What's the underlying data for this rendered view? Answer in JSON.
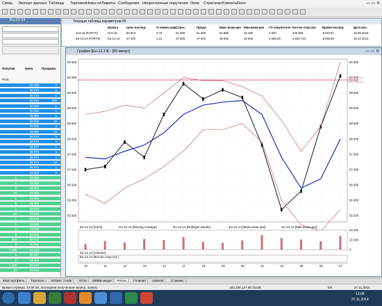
{
  "menu": [
    "Связь",
    "Экспорт данных",
    "Таблицы",
    "Торговля",
    "Новости",
    "Лимиты",
    "Сообщения",
    "Непрочтенные поручения",
    "Окна",
    "Стратегия",
    "Клиенты",
    "Окно"
  ],
  "order_book": {
    "title": "Eu-12.14",
    "columns": [
      "Покупка",
      "Цена",
      "Продажа"
    ],
    "pos_label": "POS",
    "rows": [
      {
        "price": "60 030",
        "sell": "1"
      },
      {
        "price": "60 020",
        "sell": "1"
      },
      {
        "price": "60 015",
        "sell": "1"
      },
      {
        "price": "60 010",
        "sell": "500"
      },
      {
        "price": "60 005",
        "sell": "1"
      },
      {
        "price": "60 000",
        "sell": "1"
      },
      {
        "price": "59 999",
        "sell": "5"
      },
      {
        "price": "59 988",
        "sell": "45"
      },
      {
        "price": "59 985",
        "sell": "6"
      },
      {
        "price": "59 980",
        "sell": "10"
      },
      {
        "price": "59 979",
        "sell": "2"
      },
      {
        "price": "59 978",
        "sell": "4"
      },
      {
        "price": "59 977",
        "sell": "1"
      },
      {
        "price": "59 976",
        "sell": "6"
      },
      {
        "price": "59 974",
        "sell": "2"
      },
      {
        "price": "59 972",
        "sell": "10"
      },
      {
        "price": "59 970",
        "sell": "1"
      },
      {
        "price": "59 965",
        "sell": "2"
      },
      {
        "buy": "1",
        "price": "59 960"
      },
      {
        "buy": "1",
        "price": "59 955"
      },
      {
        "buy": "2",
        "price": "59 954"
      },
      {
        "buy": "10",
        "price": "59 953"
      },
      {
        "buy": "1",
        "price": "59 950"
      },
      {
        "buy": "5",
        "price": "59 949"
      },
      {
        "buy": "1",
        "price": "59 948"
      },
      {
        "buy": "25",
        "price": "59 946"
      },
      {
        "buy": "1",
        "price": "59 945"
      },
      {
        "buy": "1",
        "price": "59 940"
      },
      {
        "buy": "1",
        "price": "59 939"
      },
      {
        "buy": "5",
        "price": "59 935"
      },
      {
        "buy": "489",
        "price": "59 932"
      },
      {
        "buy": "2",
        "price": "59 930"
      },
      {
        "buy": "2 000",
        "price": "59 928"
      },
      {
        "buy": "1",
        "price": "59 927"
      },
      {
        "buy": "1",
        "price": "59 925"
      },
      {
        "buy": "1 000",
        "price": "59 920"
      },
      {
        "buy": "10",
        "price": "59 915"
      }
    ]
  },
  "params_table": {
    "title": "Текущая таблица параметров #8",
    "headers": [
      "Бумага",
      "Цена послед.",
      "% измен.закр.",
      "Спрос",
      "Предл.",
      "Макс.возм.цен",
      "Мин.возм.цен",
      "ГО покупателя",
      "Кол-во откр.поз.",
      "Время послед.",
      "Дата исп."
    ],
    "rows": [
      [
        "Si-9.15 [FORTS]",
        "Si-9.15",
        "50 913",
        "0,75",
        "51 099",
        "51 500",
        "52 882",
        "48 180",
        "4 840",
        "333 828",
        "10:00:01",
        "15.09.2015"
      ],
      [
        "Eu-12.14 [FORTS]",
        "Eu-12.14",
        "47 922",
        "1,21",
        "47 920",
        "47 922",
        "48 652",
        "46 646",
        "2 606,00",
        "2 818 724",
        "10:08:25",
        "15.12.2014"
      ]
    ]
  },
  "chart_window": {
    "title": "График [Eu-12.14] - [60 минут]",
    "price_ticks": [
      "60 500",
      "60 000",
      "59 500",
      "59 000",
      "58 500",
      "58 000",
      "57 500",
      "57 000",
      "56 500",
      "56 000",
      "55 500"
    ],
    "last_price_tag": "59 920",
    "legend_main": [
      "Eu-12.14 [Price]",
      "Eu-12.14 [Moving Average]",
      "Eu-12.14 [Bollinger Bands]",
      "Eu-12.14 [Макс.возм.цен]",
      "Eu-12.14 [Мин.возм.цен]"
    ],
    "volume_label": "Eu-12.14 [Volume]",
    "volume_ticks": [
      "40 000",
      "20 000",
      "0"
    ],
    "oi_label": "Eu-12.14 [Кол-во откр.поз.]",
    "dates": [
      "10",
      "11",
      "12",
      "13",
      "14",
      "17",
      "18",
      "19",
      "20",
      "21",
      "24",
      "25",
      "26",
      "27"
    ],
    "colors": {
      "price": "#000000",
      "ma": "#1a2fb5",
      "bands": "#c04a4a",
      "volume": "#d07070",
      "hline": "#c83c78"
    }
  },
  "chart_data": {
    "type": "line",
    "title": "График [Eu-12.14] - [60 минут]",
    "x": [
      "10",
      "11",
      "12",
      "13",
      "14",
      "17",
      "18",
      "19",
      "20",
      "21",
      "24",
      "25",
      "26",
      "27"
    ],
    "series": [
      {
        "name": "Eu-12.14 [Price]",
        "values": [
          57000,
          57100,
          57900,
          57400,
          58800,
          59800,
          59300,
          59600,
          59350,
          57800,
          55700,
          56300,
          58400,
          60050
        ]
      },
      {
        "name": "Eu-12.14 [Moving Average]",
        "values": [
          57400,
          57350,
          57600,
          57800,
          58200,
          58800,
          59100,
          59200,
          59250,
          58800,
          57400,
          56400,
          56700,
          58000
        ]
      },
      {
        "name": "Eu-12.14 [Bollinger Bands] upper",
        "values": [
          58800,
          58900,
          59100,
          59000,
          59500,
          60000,
          59900,
          59900,
          59700,
          59400,
          58600,
          57600,
          58400,
          60500
        ]
      },
      {
        "name": "Eu-12.14 [Bollinger Bands] lower",
        "values": [
          56200,
          55900,
          56400,
          56700,
          57100,
          57600,
          58300,
          58300,
          58500,
          57900,
          56000,
          55200,
          55000,
          55700
        ]
      }
    ],
    "ylim": [
      55300,
      60600
    ],
    "volume": [
      12000,
      18000,
      15000,
      22000,
      20000,
      26000,
      16000,
      14000,
      19000,
      30000,
      24000,
      21000,
      17000,
      28000
    ],
    "volume_ylim": [
      0,
      40000
    ],
    "hline": 59920
  },
  "bottom_tabs": [
    "Мой портфель",
    "Торговля",
    "ЮОМА",
    "Farts",
    "RTSI",
    "ММВБ-акции",
    "RiMain",
    "Главная",
    "Indexes",
    "Стаканы"
  ],
  "status": {
    "text": "Время сервера: 10:08:25; последняя полученная запись: 42354)",
    "conn": "193.239.127.50:15100",
    "lang": "EN",
    "date": "27.11.2014"
  },
  "taskbar": {
    "time": "13:08",
    "date": "27.11.2014"
  }
}
